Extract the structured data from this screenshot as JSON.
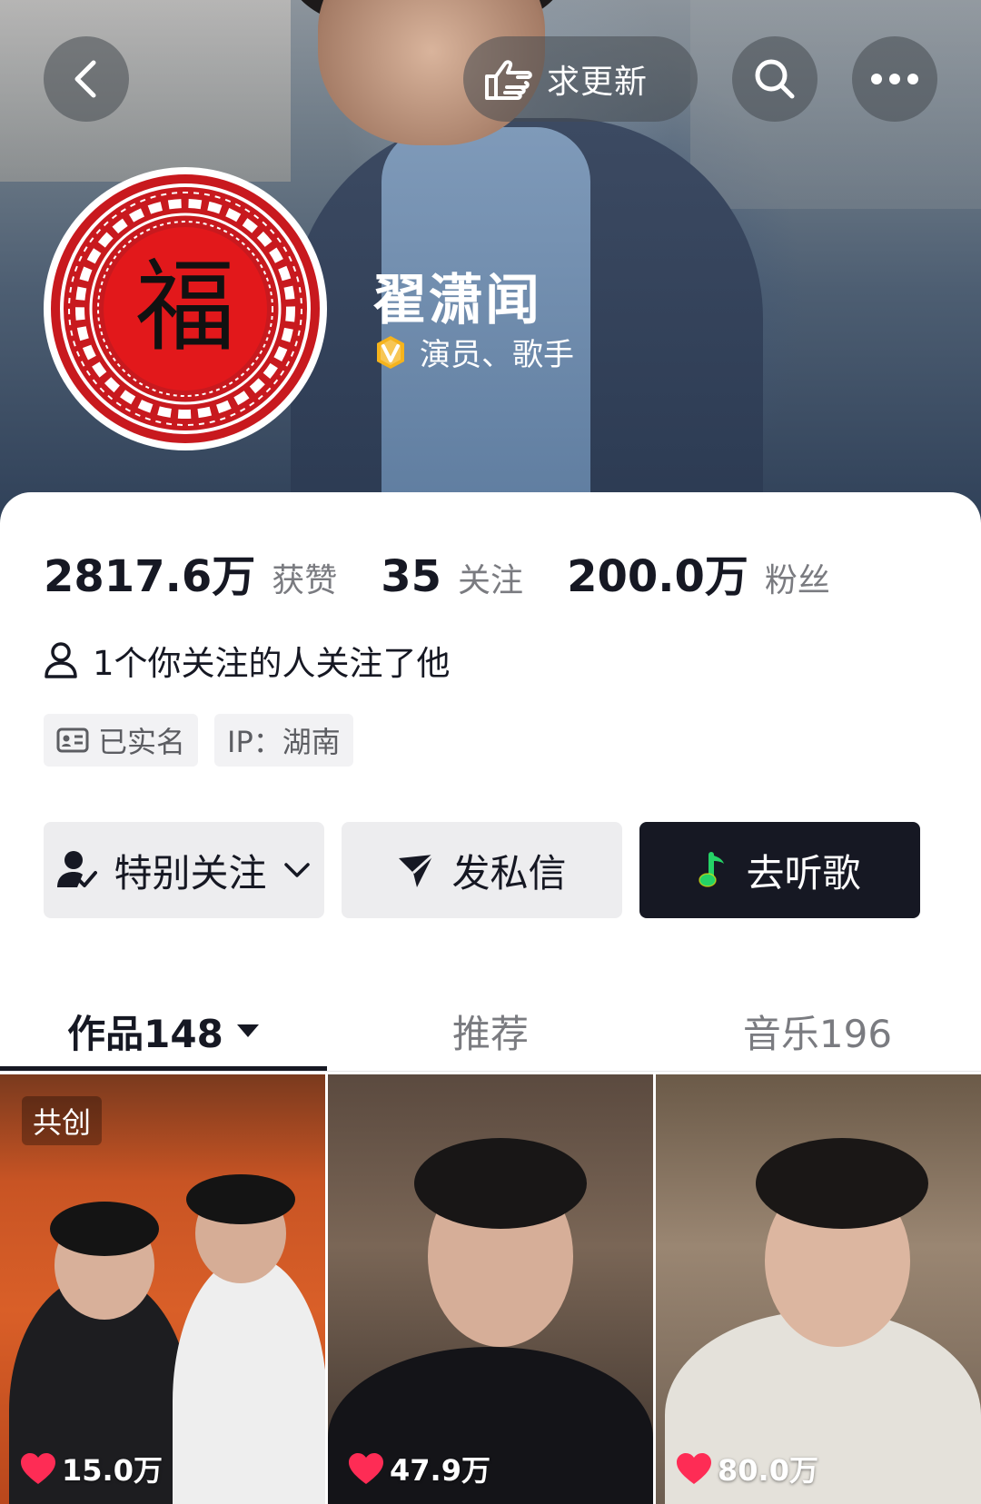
{
  "header": {
    "update_button_label": "求更新"
  },
  "profile": {
    "name": "翟潇闻",
    "verification": "演员、歌手",
    "avatar_text": "福"
  },
  "stats": [
    {
      "value": "2817.6万",
      "label": "获赞"
    },
    {
      "value": "35",
      "label": "关注"
    },
    {
      "value": "200.0万",
      "label": "粉丝"
    }
  ],
  "mutual_follow": "1个你关注的人关注了他",
  "tags": {
    "realname": "已实名",
    "ip": "IP：湖南"
  },
  "actions": {
    "special_follow": "特别关注",
    "message": "发私信",
    "listen": "去听歌"
  },
  "tabs": [
    {
      "label": "作品148",
      "active": true
    },
    {
      "label": "推荐",
      "active": false
    },
    {
      "label": "音乐196",
      "active": false
    }
  ],
  "videos": [
    {
      "badge": "共创",
      "likes": "15.0万"
    },
    {
      "badge": "",
      "likes": "47.9万"
    },
    {
      "badge": "",
      "likes": "80.0万"
    }
  ],
  "icons": [
    "back-icon",
    "hand-point-icon",
    "search-icon",
    "more-icon",
    "verified-icon",
    "user-icon",
    "id-card-icon",
    "user-check-icon",
    "chevron-down-icon",
    "send-icon",
    "music-note-icon",
    "caret-down-icon",
    "heart-icon"
  ],
  "colors": {
    "avatar_red": "#c8191e",
    "like_heart": "#fe2c55",
    "listen_button": "#161823",
    "music_note_green": "#25d366"
  }
}
